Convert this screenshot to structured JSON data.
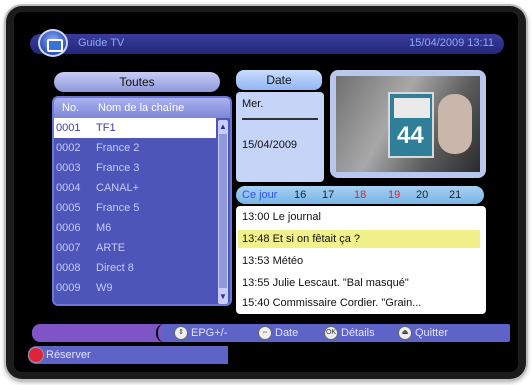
{
  "header": {
    "title": "Guide TV",
    "datetime": "15/04/2009 13:11"
  },
  "channels": {
    "category": "Toutes",
    "col_no": "No.",
    "col_name": "Nom de la chaîne",
    "rows": [
      {
        "n": "0001",
        "name": "TF1"
      },
      {
        "n": "0002",
        "name": "France 2"
      },
      {
        "n": "0003",
        "name": "France 3"
      },
      {
        "n": "0004",
        "name": "CANAL+"
      },
      {
        "n": "0005",
        "name": "France 5"
      },
      {
        "n": "0006",
        "name": "M6"
      },
      {
        "n": "0007",
        "name": "ARTE"
      },
      {
        "n": "0008",
        "name": "Direct 8"
      },
      {
        "n": "0009",
        "name": "W9"
      }
    ],
    "selected_index": 0
  },
  "date": {
    "label": "Date",
    "day": "Mer.",
    "full_date": "15/04/2009"
  },
  "preview": {
    "channel_number": "44"
  },
  "days": {
    "today": "Ce jour",
    "d16": "16",
    "d17": "17",
    "d18": "18",
    "d19": "19",
    "d20": "20",
    "d21": "21"
  },
  "programs": [
    "13:00 Le journal",
    "13:48 Et si on fêtait ça ?",
    "13:53 Météo",
    "13:55 Julie Lescaut. \"Bal masqué\"",
    "15:40 Commissaire Cordier. \"Grain..."
  ],
  "hints": {
    "epg": "EPG+/-",
    "date": "Date",
    "details": "Détails",
    "quit": "Quitter",
    "reserve": "Réserver"
  }
}
